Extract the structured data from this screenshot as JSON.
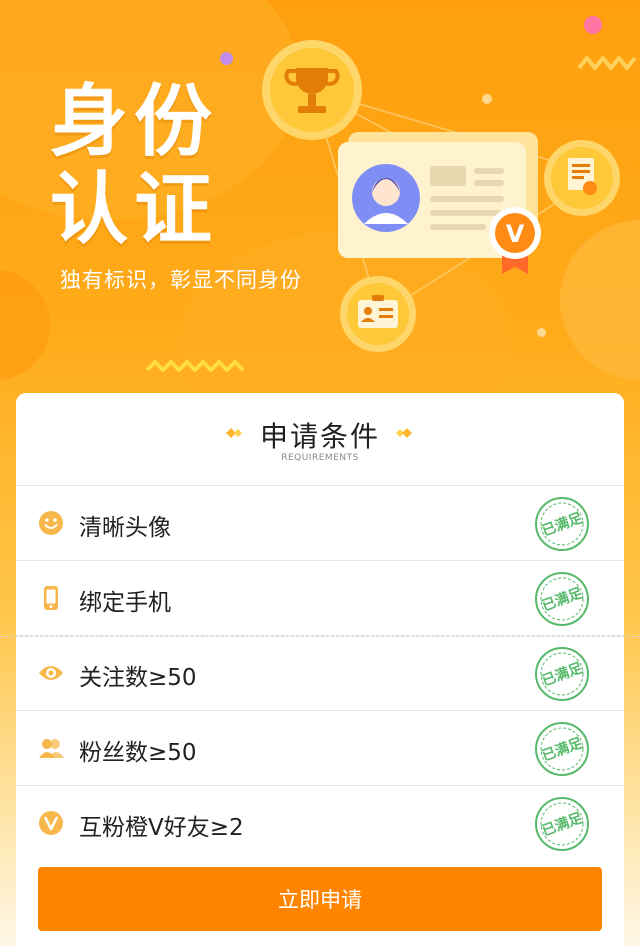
{
  "hero": {
    "title_line1": "身份",
    "title_line2": "认证",
    "subtitle": "独有标识，彰显不同身份",
    "badge_letter": "V"
  },
  "card": {
    "title": "申请条件",
    "subtitle": "REQUIREMENTS"
  },
  "requirements": [
    {
      "icon": "smiley-icon",
      "label": "清晰头像",
      "status": "已满足"
    },
    {
      "icon": "phone-icon",
      "label": "绑定手机",
      "status": "已满足"
    },
    {
      "icon": "eye-icon",
      "label": "关注数≥50",
      "status": "已满足"
    },
    {
      "icon": "fans-icon",
      "label": "粉丝数≥50",
      "status": "已满足"
    },
    {
      "icon": "v-badge-icon",
      "label": "互粉橙V好友≥2",
      "status": "已满足"
    }
  ],
  "apply_button": "立即申请",
  "colors": {
    "accent": "#ff8500",
    "icon": "#f8b74a",
    "stamp": "#57b96a"
  }
}
